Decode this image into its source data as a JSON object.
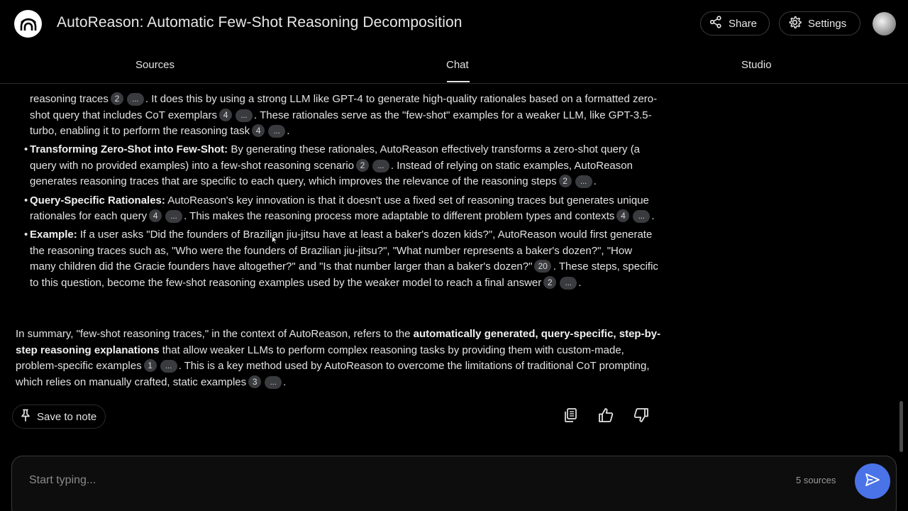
{
  "header": {
    "title": "AutoReason: Automatic Few-Shot Reasoning Decomposition",
    "share_label": "Share",
    "settings_label": "Settings"
  },
  "tabs": [
    "Sources",
    "Chat",
    "Studio"
  ],
  "chat": {
    "p0": {
      "t1": "reasoning traces",
      "c1": "2",
      "t2": ". It does this by using a strong LLM like GPT-4 to generate high-quality rationales based on a formatted zero-shot query that includes CoT exemplars",
      "c2": "4",
      "t3": ". These rationales serve as the \"few-shot\" examples for a weaker LLM, like GPT-3.5-turbo, enabling it to perform the reasoning task",
      "c3": "4",
      "t4": "."
    },
    "b1": {
      "title": "Transforming Zero-Shot into Few-Shot:",
      "t1": " By generating these rationales, AutoReason effectively transforms a zero-shot query (a query with no provided examples) into a few-shot reasoning scenario",
      "c1": "2",
      "t2": ". Instead of relying on static examples, AutoReason generates reasoning traces that are specific to each query, which improves the relevance of the reasoning steps",
      "c2": "2",
      "t3": "."
    },
    "b2": {
      "title": "Query-Specific Rationales:",
      "t1": " AutoReason's key innovation is that it doesn't use a fixed set of reasoning traces but generates unique rationales for each query",
      "c1": "4",
      "t2": ". This makes the reasoning process more adaptable to different problem types and contexts",
      "c2": "4",
      "t3": "."
    },
    "b3": {
      "title": "Example:",
      "t1": " If a user asks \"Did the founders of Brazilian jiu-jitsu have at least a baker's dozen kids?\", AutoReason would first generate the reasoning traces such as, \"Who were the founders of Brazilian jiu-jitsu?\", \"What number represents a baker's dozen?\", \"How many children did the Gracie founders have altogether?\" and \"Is that number larger than a baker's dozen?\"",
      "c1": "20",
      "t2": ". These steps, specific to this question, become the few-shot reasoning examples used by the weaker model to reach a final answer",
      "c2": "2",
      "t3": "."
    },
    "summary": {
      "t1": "In summary, \"few-shot reasoning traces,\" in the context of AutoReason, refers to the ",
      "bold": "automatically generated, query-specific, step-by-step reasoning explanations",
      "t2": " that allow weaker LLMs to perform complex reasoning tasks by providing them with custom-made, problem-specific examples",
      "c1": "1",
      "t3": ". This is a key method used by AutoReason to overcome the limitations of traditional CoT prompting, which relies on manually crafted, static examples",
      "c2": "3",
      "t4": "."
    },
    "more_label": "...",
    "bullet": "•",
    "save_note_label": "Save to note"
  },
  "input": {
    "placeholder": "Start typing...",
    "sources_count": "5 sources"
  },
  "icons": {
    "logo": "notebook-logo-icon",
    "share": "share-icon",
    "settings": "gear-icon",
    "pin": "pin-icon",
    "copy": "copy-icon",
    "thumbs_up": "thumbs-up-icon",
    "thumbs_down": "thumbs-down-icon",
    "send": "send-icon"
  },
  "colors": {
    "background": "#000000",
    "chip": "#3a3b3e",
    "send_button": "#4a73e8"
  }
}
